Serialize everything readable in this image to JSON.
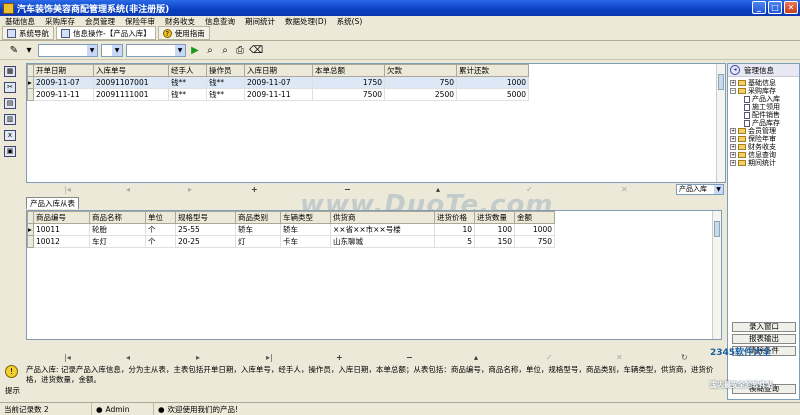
{
  "window": {
    "title": "汽车装饰美容商配管理系统(非注册版)"
  },
  "menu": [
    "基础信息",
    "采购库存",
    "会员管理",
    "保险年审",
    "财务收支",
    "信息查询",
    "期间统计",
    "数据处理(D)",
    "系统(S)"
  ],
  "tabs": [
    {
      "label": "系统导航"
    },
    {
      "label": "信息操作-【产品入库】"
    },
    {
      "label": "使用指南"
    }
  ],
  "main_grid": {
    "columns": [
      "开单日期",
      "入库单号",
      "经手人",
      "操作员",
      "入库日期",
      "本单总额",
      "欠款",
      "累计还款"
    ],
    "rows": [
      [
        "2009-11-07",
        "20091107001",
        "钱**",
        "钱**",
        "2009-11-07",
        "1750",
        "750",
        "1000"
      ],
      [
        "2009-11-11",
        "20091111001",
        "钱**",
        "钱**",
        "2009-11-11",
        "7500",
        "2500",
        "5000"
      ]
    ]
  },
  "nav_symbols": {
    "first": "|◂",
    "prev": "◂",
    "next": "▸",
    "last": "▸|",
    "add": "+",
    "del": "−",
    "up": "▴",
    "ok": "✓",
    "cancel": "✕",
    "refresh": "↻"
  },
  "detail_selector": "产品入库",
  "sub_tab": "产品入库从表",
  "detail_grid": {
    "columns": [
      "商品编号",
      "商品名称",
      "单位",
      "规格型号",
      "商品类别",
      "车辆类型",
      "供货商",
      "进货价格",
      "进货数量",
      "金额"
    ],
    "rows": [
      [
        "10011",
        "轮胎",
        "个",
        "25-55",
        "轿车",
        "轿车",
        "××省××市××号楼",
        "10",
        "100",
        "1000"
      ],
      [
        "10012",
        "车灯",
        "个",
        "20-25",
        "灯",
        "卡车",
        "山东聊城",
        "5",
        "150",
        "750"
      ]
    ]
  },
  "right_panel": {
    "header": "管理信息",
    "tree": [
      {
        "label": "基础信息",
        "level": 0,
        "kind": "folder",
        "pm": "+"
      },
      {
        "label": "采购库存",
        "level": 0,
        "kind": "folder",
        "pm": "−"
      },
      {
        "label": "产品入库",
        "level": 1,
        "kind": "doc"
      },
      {
        "label": "施工领用",
        "level": 1,
        "kind": "doc"
      },
      {
        "label": "配件销售",
        "level": 1,
        "kind": "doc"
      },
      {
        "label": "产品库存",
        "level": 1,
        "kind": "doc"
      },
      {
        "label": "会员管理",
        "level": 0,
        "kind": "folder",
        "pm": "+"
      },
      {
        "label": "保险年审",
        "level": 0,
        "kind": "folder",
        "pm": "+"
      },
      {
        "label": "财务收支",
        "level": 0,
        "kind": "folder",
        "pm": "+"
      },
      {
        "label": "信息查询",
        "level": 0,
        "kind": "folder",
        "pm": "+"
      },
      {
        "label": "期间统计",
        "level": 0,
        "kind": "folder",
        "pm": "+"
      }
    ],
    "buttons": [
      "录入窗口",
      "报表输出",
      "清除条件",
      "模糊查询"
    ]
  },
  "description": "产品入库: 记录产品入库信息，分为主从表，主表包括开单日期，入库单号，经手人，操作员，入库日期，本单总额；从表包括：商品编号，商品名称，单位，规格型号，商品类别，车辆类型，供货商，进货价格，进货数量，金额。",
  "hint_label": "提示",
  "status": {
    "records": "当前记录数 2",
    "user": "Admin",
    "welcome": "欢迎使用我们的产品!"
  },
  "watermark": "www.DuoTe.com",
  "badge": {
    "line1": "2345软件大全",
    "line2": "国内最安全的软件站"
  },
  "icons": [
    "pencil-icon",
    "filter-icon",
    "run-icon",
    "find-icon",
    "find-next-icon",
    "print-icon",
    "clear-icon"
  ]
}
